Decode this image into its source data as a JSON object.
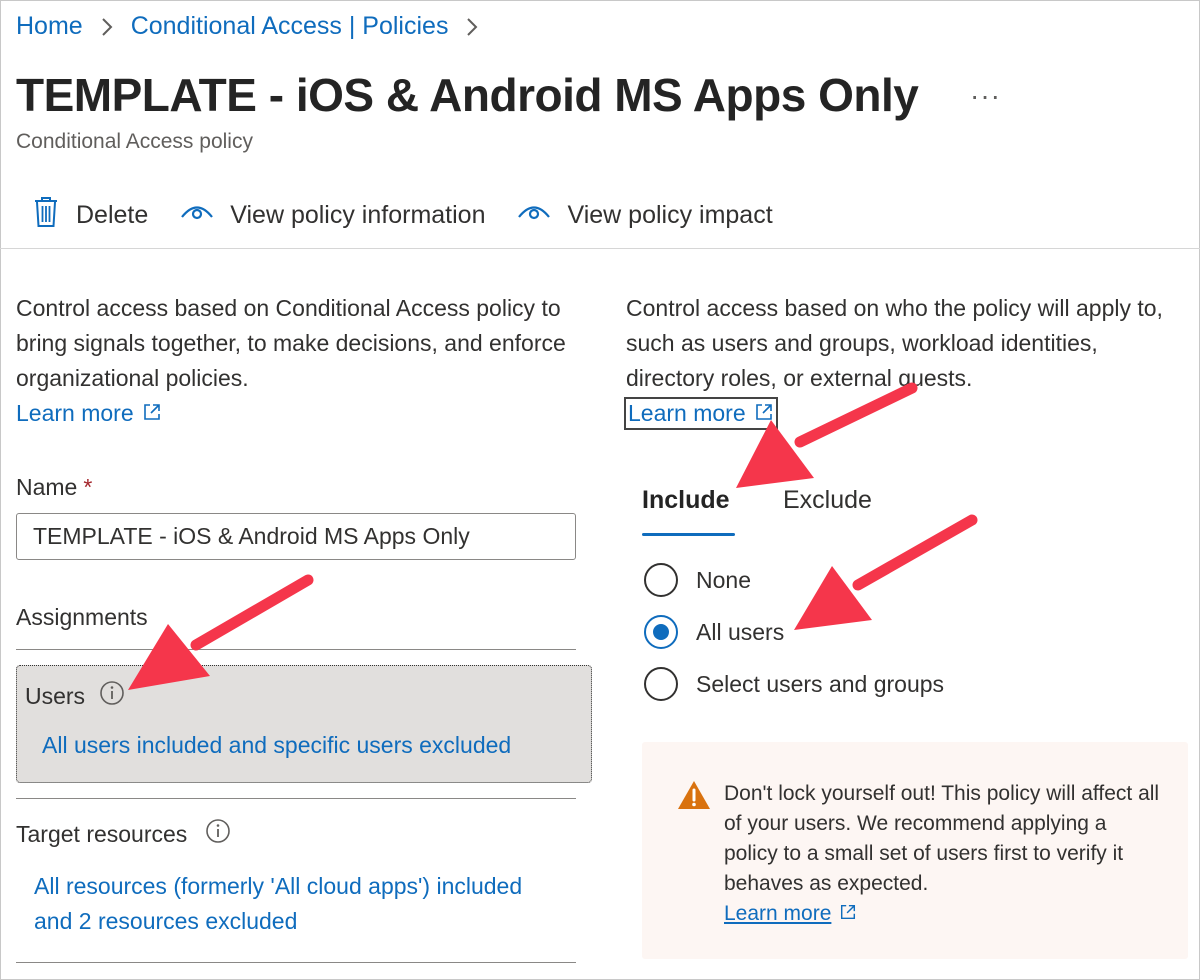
{
  "breadcrumb": [
    {
      "label": "Home"
    },
    {
      "label": "Conditional Access | Policies"
    }
  ],
  "page": {
    "title": "TEMPLATE - iOS & Android MS Apps Only",
    "more": "···",
    "subtitle": "Conditional Access policy"
  },
  "toolbar": {
    "delete": "Delete",
    "view_info": "View policy information",
    "view_impact": "View policy impact"
  },
  "left": {
    "description": "Control access based on Conditional Access policy to bring signals together, to make decisions, and enforce organizational policies.",
    "learn_more": "Learn more",
    "name_label": "Name",
    "required": "*",
    "name_value": "TEMPLATE - iOS & Android MS Apps Only",
    "assignments_title": "Assignments",
    "users_label": "Users",
    "users_value": "All users included and specific users excluded",
    "target_label": "Target resources",
    "target_value": "All resources (formerly 'All cloud apps') included and 2 resources excluded"
  },
  "right": {
    "description": "Control access based on who the policy will apply to, such as users and groups, workload identities, directory roles, or external guests.",
    "learn_more": "Learn more",
    "tabs": [
      {
        "label": "Include",
        "selected": true
      },
      {
        "label": "Exclude",
        "selected": false
      }
    ],
    "radios": [
      {
        "label": "None",
        "checked": false
      },
      {
        "label": "All users",
        "checked": true
      },
      {
        "label": "Select users and groups",
        "checked": false
      }
    ],
    "warning": {
      "text": "Don't lock yourself out! This policy will affect all of your users. We recommend applying a policy to a small set of users first to verify it behaves as expected.",
      "learn_more": "Learn more"
    }
  },
  "colors": {
    "link": "#0f6cbd",
    "annotation_arrow": "#f5364b",
    "warning_icon": "#d9720f",
    "users_box_bg": "#e1dfdd"
  },
  "icons": [
    "chevron-right-icon",
    "more-icon",
    "trash-icon",
    "eye-icon",
    "external-link-icon",
    "info-icon",
    "warning-icon"
  ]
}
